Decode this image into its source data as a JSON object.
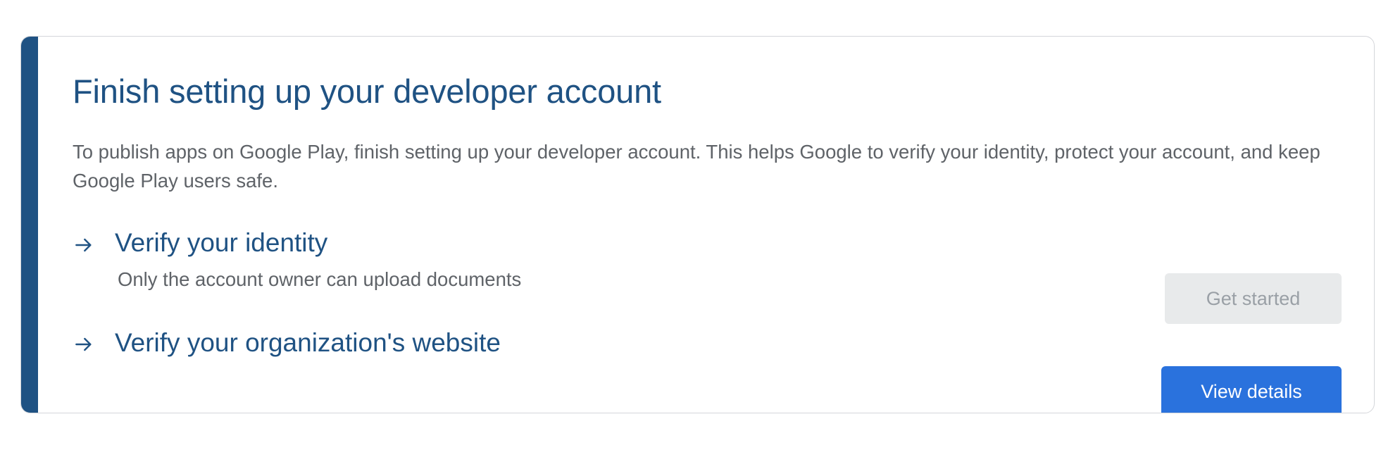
{
  "card": {
    "title": "Finish setting up your developer account",
    "description": "To publish apps on Google Play, finish setting up your developer account. This helps Google to verify your identity, protect your account, and keep Google Play users safe.",
    "accent_color": "#1f5283"
  },
  "steps": [
    {
      "icon": "arrow-right-icon",
      "title": "Verify your identity",
      "subtitle": "Only the account owner can upload documents",
      "button_label": "Get started",
      "button_state": "disabled"
    },
    {
      "icon": "arrow-right-icon",
      "title": "Verify your organization's website",
      "button_label": "View details",
      "button_state": "enabled",
      "button_color": "#2a72dd"
    }
  ]
}
